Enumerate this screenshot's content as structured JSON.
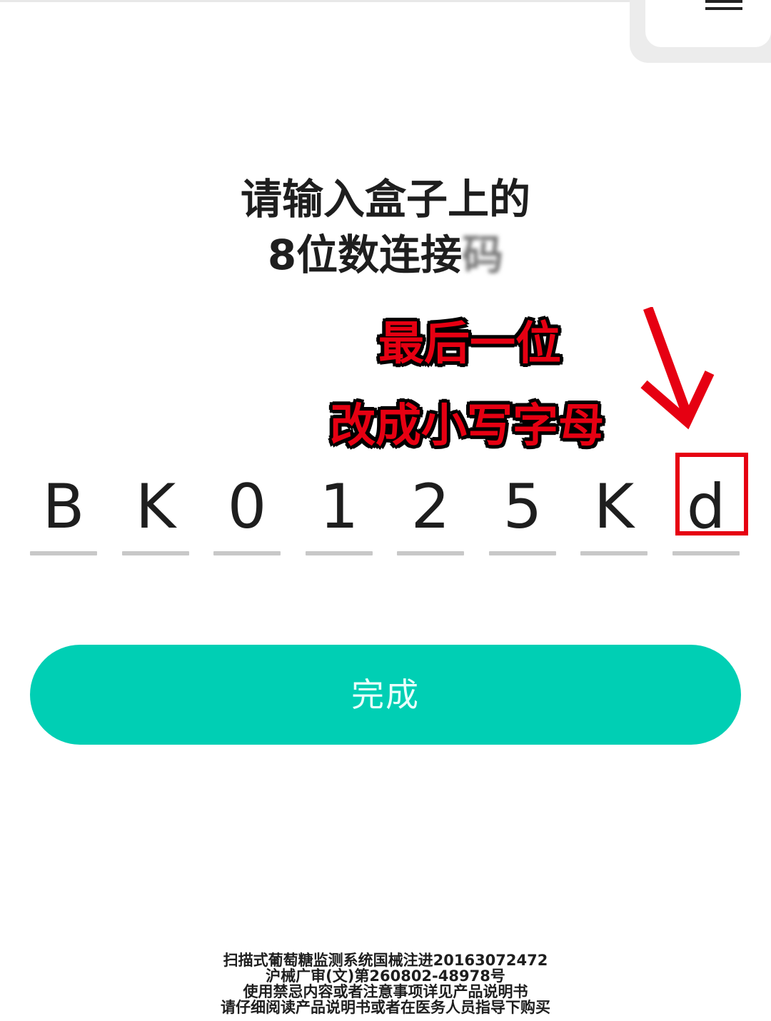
{
  "title": {
    "line1": "请输入盒子上的",
    "line2_prefix": "8位数连接",
    "line2_blurred": "码"
  },
  "annotation": {
    "line1": "最后一位",
    "line2": "改成小写字母",
    "color": "#e60012"
  },
  "code": {
    "chars": [
      "B",
      "K",
      "0",
      "1",
      "2",
      "5",
      "K",
      "d"
    ],
    "highlighted_index": 7
  },
  "button": {
    "label": "完成",
    "color": "#00cfb4"
  },
  "footer": {
    "lines": [
      "扫描式葡萄糖监测系统国械注进20163072472",
      "沪械广审(文)第260802-48978号",
      "使用禁忌内容或者注意事项详见产品说明书",
      "请仔细阅读产品说明书或者在医务人员指导下购买"
    ]
  },
  "icons": {
    "corner": "menu-icon",
    "arrow": "arrow-down-icon"
  }
}
